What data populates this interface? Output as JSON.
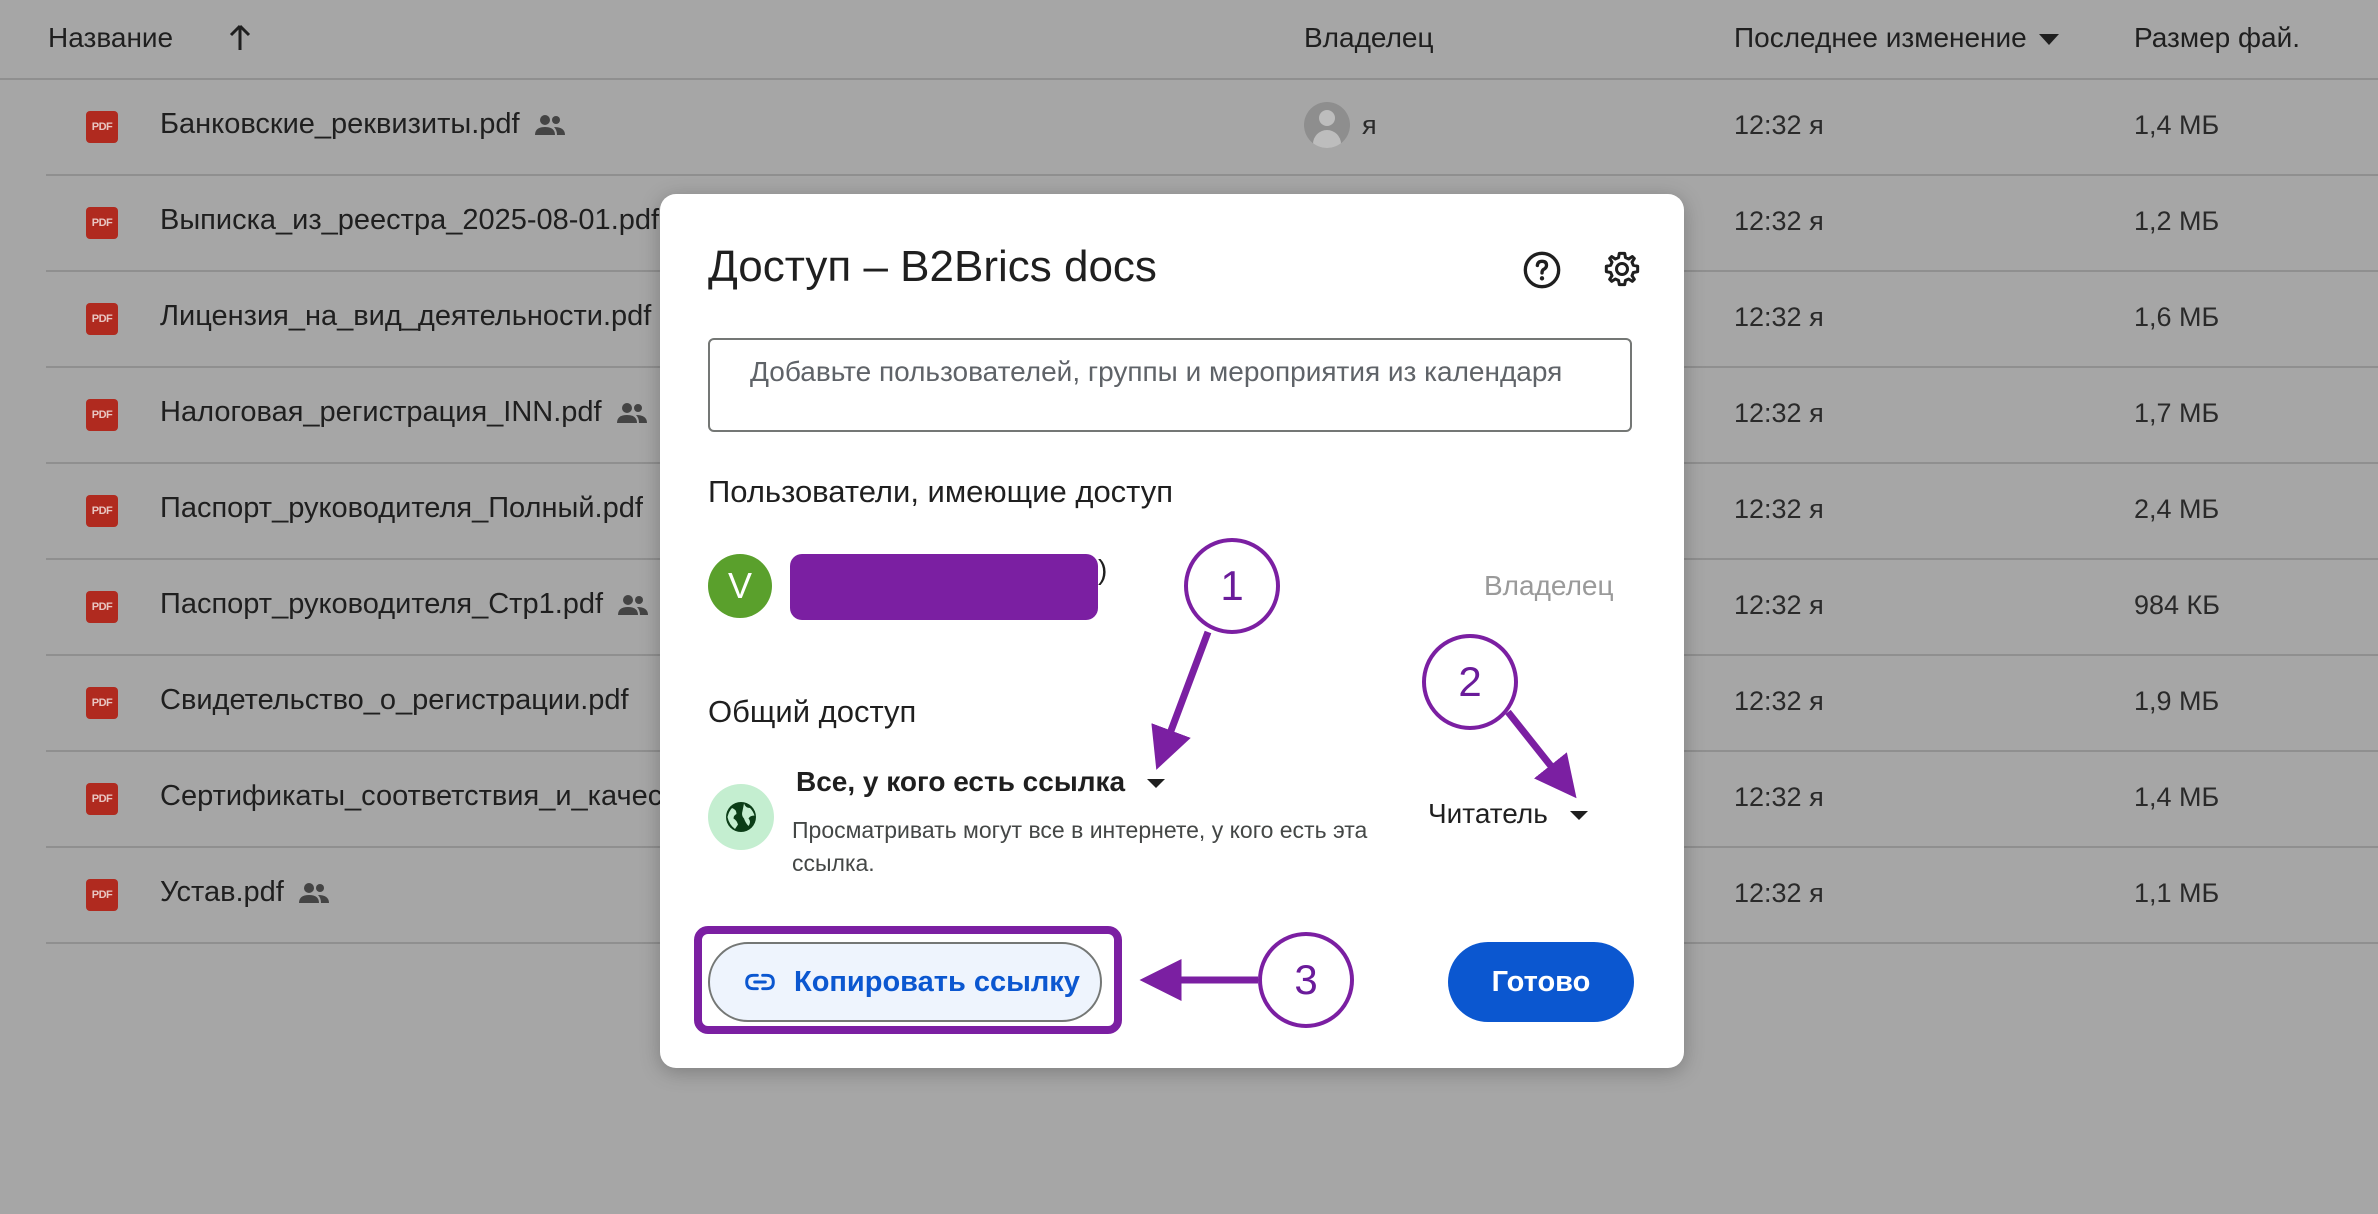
{
  "file_list": {
    "columns": {
      "name": "Название",
      "owner": "Владелец",
      "modified": "Последнее изменение",
      "size": "Размер фай."
    },
    "pdf_icon_text": "PDF",
    "rows": [
      {
        "name": "Банковские_реквизиты.pdf",
        "owner": "я",
        "modified": "12:32 я",
        "size": "1,4 МБ"
      },
      {
        "name": "Выписка_из_реестра_2025-08-01.pdf",
        "modified": "12:32 я",
        "size": "1,2 МБ"
      },
      {
        "name": "Лицензия_на_вид_деятельности.pdf",
        "modified": "12:32 я",
        "size": "1,6 МБ"
      },
      {
        "name": "Налоговая_регистрация_INN.pdf",
        "modified": "12:32 я",
        "size": "1,7 МБ"
      },
      {
        "name": "Паспорт_руководителя_Полный.pdf",
        "modified": "12:32 я",
        "size": "2,4 МБ"
      },
      {
        "name": "Паспорт_руководителя_Стр1.pdf",
        "modified": "12:32 я",
        "size": "984 КБ"
      },
      {
        "name": "Свидетельство_о_регистрации.pdf",
        "modified": "12:32 я",
        "size": "1,9 МБ"
      },
      {
        "name": "Сертификаты_соответствия_и_качества.pdf",
        "modified": "12:32 я",
        "size": "1,4 МБ"
      },
      {
        "name": "Устав.pdf",
        "modified": "12:32 я",
        "size": "1,1 МБ"
      }
    ]
  },
  "dialog": {
    "title": "Доступ – B2Brics docs",
    "add_placeholder": "Добавьте пользователей, группы и мероприятия из календаря",
    "people_heading": "Пользователи, имеющие доступ",
    "user_initial": "V",
    "user_suffix": ")",
    "owner_role": "Владелец",
    "general_heading": "Общий доступ",
    "link_option": "Все, у кого есть ссылка",
    "link_description": "Просматривать могут все в интернете, у кого есть эта ссылка.",
    "role": "Читатель",
    "copy_link": "Копировать ссылку",
    "done": "Готово"
  },
  "annotations": {
    "callouts": [
      "1",
      "2",
      "3"
    ],
    "color": "#7b1fa2"
  },
  "colors": {
    "accent": "#0b57d0",
    "avatar": "#5aa02c",
    "pdf": "#b02a1f"
  }
}
